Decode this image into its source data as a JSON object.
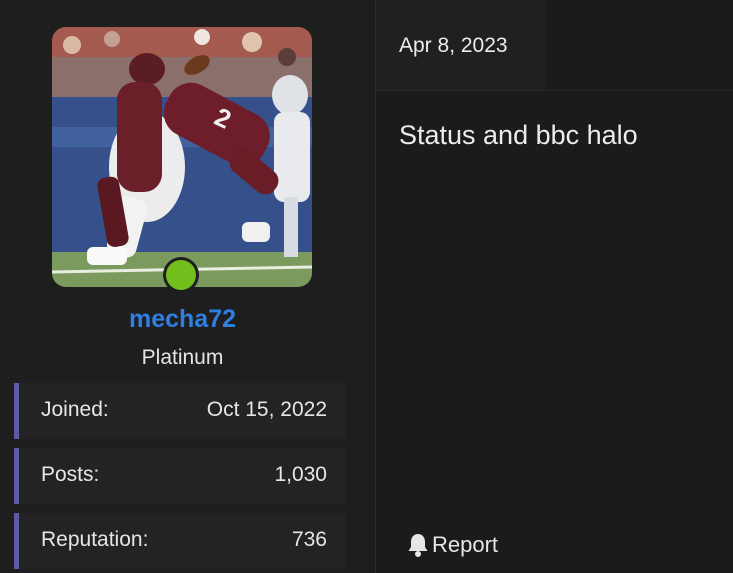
{
  "user": {
    "avatar": {
      "description_icon": "user-avatar-football-photo",
      "online_status_color": "#71be1c"
    },
    "username": "mecha72",
    "username_color": "#2f7fe1",
    "title": "Platinum",
    "stats": [
      {
        "label": "Joined:",
        "value": "Oct 15, 2022"
      },
      {
        "label": "Posts:",
        "value": "1,030"
      },
      {
        "label": "Reputation:",
        "value": "736"
      }
    ],
    "stat_accent_color": "#5d5aa6"
  },
  "post": {
    "date": "Apr 8, 2023",
    "body": "Status and bbc halo",
    "report_label": "Report",
    "report_icon": "bell-icon"
  }
}
